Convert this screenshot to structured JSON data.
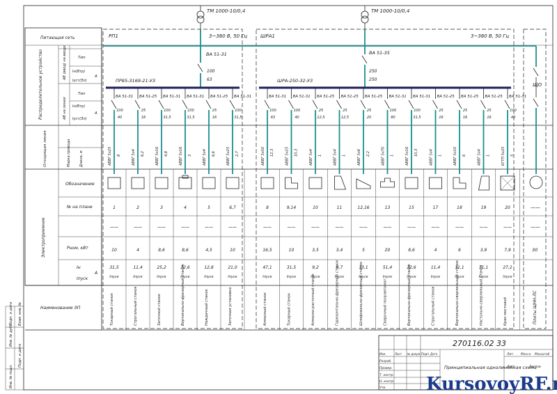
{
  "transformers": [
    "ТМ 1000-10/0,4",
    "ТМ 1000-10/0,4"
  ],
  "panels": {
    "rp1": {
      "name": "РП1",
      "supply": "3~380 В, 50 Гц",
      "breaker": "ВА 51-31",
      "rating_top": "100",
      "rating_bottom": "63",
      "cabinet": "ПР85-3169-21-УЗ"
    },
    "shra1": {
      "name": "ШРА1",
      "supply": "3~380 В, 50 Гц",
      "breaker": "ВА 51-35",
      "rating_top": "250",
      "rating_bottom": "250",
      "cabinet": "ШРА-250-32-УЗ"
    },
    "shu": {
      "name": "ЩО"
    }
  },
  "row_labels": {
    "supply_network": "Питающая сеть",
    "distribution_device": "Распределительное устройство",
    "input_device": "АВ (ввод) на вводе",
    "breaker_device": "АВ на линии",
    "type": "Тип",
    "i_nom": "Iн(Втр)",
    "i_set": "Iуст(Эл)",
    "unit_a": "А",
    "feeder_line": "Отходящая линия",
    "wire_mark": "Марка провода",
    "length": "Длина, м",
    "consumer": "Электроприемник",
    "symbol": "Обозначение",
    "plan_no": "№ на плане",
    "power_nominal": "Pном, кВт",
    "i_nom_unit": "Iном А Iпуск",
    "i_work": "Iн",
    "name": "Наименование ЭП"
  },
  "rp1_feeders": [
    {
      "breaker": "ВА 51-31",
      "rating": "100/40",
      "cable": "АВВГ 5х25",
      "length": "8",
      "plan": "1",
      "power": "10",
      "inom": "31,5",
      "istart": "Iпуск",
      "name": "Токарный станок"
    },
    {
      "breaker": "ВА 51-25",
      "rating": "25/16",
      "cable": "АВВГ 5х4",
      "length": "6,2",
      "plan": "2",
      "power": "4",
      "inom": "11,4",
      "istart": "Iпуск",
      "name": "Строгальный станок"
    },
    {
      "breaker": "ВА 51-31",
      "rating": "100/31,5",
      "cable": "АВВГ 5х16",
      "length": "4,8",
      "plan": "3",
      "power": "8,6",
      "inom": "25,2",
      "istart": "Iпуск",
      "name": "Заточной станок"
    },
    {
      "breaker": "ВА 51-31",
      "rating": "100/31,5",
      "cable": "АВВГ 5х16",
      "length": "3",
      "plan": "4",
      "power": "8,6",
      "inom": "22,6",
      "istart": "Iпуск",
      "name": "Вертикально-фрезерный станок"
    },
    {
      "breaker": "ВА 51-25",
      "rating": "25/16",
      "cable": "АВВГ 5х4",
      "length": "6,6",
      "plan": "5",
      "power": "4,5",
      "inom": "12,8",
      "istart": "Iпуск",
      "name": "Наждачный станок"
    },
    {
      "breaker": "ВА 51-31",
      "rating": "100/31,5",
      "cable": "АВВГ 5х25",
      "length": "2,7",
      "plan": "6,7",
      "power": "10",
      "inom": "21,0",
      "istart": "Iпуск",
      "name": "Заточная установка"
    }
  ],
  "shra_feeders": [
    {
      "breaker": "ВА 51-31",
      "rating": "100/63",
      "cable": "АВВГ 5х50",
      "length": "12,3",
      "plan": "8",
      "power": "16,5",
      "inom": "47,1",
      "istart": "Iпуск",
      "name": "Алмазный станок"
    },
    {
      "breaker": "ВА 51-31",
      "rating": "100/40",
      "cable": "АВВГ 5х25",
      "length": "10,3",
      "plan": "9,14",
      "power": "10",
      "inom": "31,5",
      "istart": "Iпуск",
      "name": "Токарный станок"
    },
    {
      "breaker": "ВА 51-25",
      "rating": "25/12,5",
      "cable": "АВВГ 5х4",
      "length": "1",
      "plan": "10",
      "power": "3,5",
      "inom": "9,2",
      "istart": "Iпуск",
      "name": "Алмазно-расточный станок"
    },
    {
      "breaker": "ВА 51-25",
      "rating": "25/12,5",
      "cable": "АВВГ 5х4",
      "length": "1",
      "plan": "11",
      "power": "3,4",
      "inom": "9,7",
      "istart": "Iпуск",
      "name": "Горизонтально-фрезерный станок"
    },
    {
      "breaker": "ВА 51-25",
      "rating": "25/20",
      "cable": "АВВГ 5х6",
      "length": "2,2",
      "plan": "12,16",
      "power": "5",
      "inom": "13,1",
      "istart": "Iпуск",
      "name": "Шлифовально-фрезерный станок"
    },
    {
      "breaker": "ВА 51-31",
      "rating": "100/80",
      "cable": "АВВГ 5х70",
      "length": "1",
      "plan": "13",
      "power": "20",
      "inom": "51,4",
      "istart": "Iпуск",
      "name": "Сварочный полуавтомат"
    },
    {
      "breaker": "ВА 51-31",
      "rating": "100/31,5",
      "cable": "АВВГ 5х16",
      "length": "10,3",
      "plan": "15",
      "power": "8,6",
      "inom": "22,6",
      "istart": "Iпуск",
      "name": "Вертикально-фрезерный станок"
    },
    {
      "breaker": "ВА 51-25",
      "rating": "25/16",
      "cable": "АВВГ 5х4",
      "length": "1",
      "plan": "17",
      "power": "4",
      "inom": "11,4",
      "istart": "Iпуск",
      "name": "Строгальный станок"
    },
    {
      "breaker": "ВА 51-25",
      "rating": "25/16",
      "cable": "АВВГ 5х10",
      "length": "6",
      "plan": "18",
      "power": "6",
      "inom": "11,1",
      "istart": "Iпуск",
      "name": "Вертикально-сверлильный станок"
    },
    {
      "breaker": "ВА 51-25",
      "rating": "25/16",
      "cable": "АВВГ 5х4",
      "length": "1",
      "plan": "19",
      "power": "3,9",
      "inom": "11,1",
      "istart": "Iпуск",
      "name": "Настольно-сверлильный станок"
    },
    {
      "breaker": "ВА 51-31",
      "rating": "100/40",
      "cable": "КГТП 5х25",
      "length": "5",
      "plan": "20",
      "power": "7,9",
      "inom": "27,2",
      "istart": "Iпуск",
      "name": "Кран мостовой"
    }
  ],
  "lighting": {
    "plan": "——",
    "power": "30",
    "name": "Плиты ЩНН-ЛС",
    "dash": "——"
  },
  "dash_cell": "——",
  "title_block": {
    "code": "270116.02 33",
    "title": "Принципиальная однолинейная схема",
    "rows": [
      "Разраб.",
      "Провер.",
      "Т. контр.",
      "Н. контр.",
      "Утв."
    ],
    "cols": [
      "Изм.",
      "Лист",
      "№ докум.",
      "Подп.",
      "Дата"
    ],
    "sheet_labels": [
      "Лит.",
      "Масса",
      "Масштаб"
    ],
    "sheet": "Лист",
    "sheets": "Листов"
  },
  "side_stamps": [
    "Подп. и дата",
    "Инв. № дубл.",
    "Взам. инв. №",
    "Подп. и дата",
    "Инв. № подл."
  ],
  "watermark": "KursovoyRF.ru"
}
